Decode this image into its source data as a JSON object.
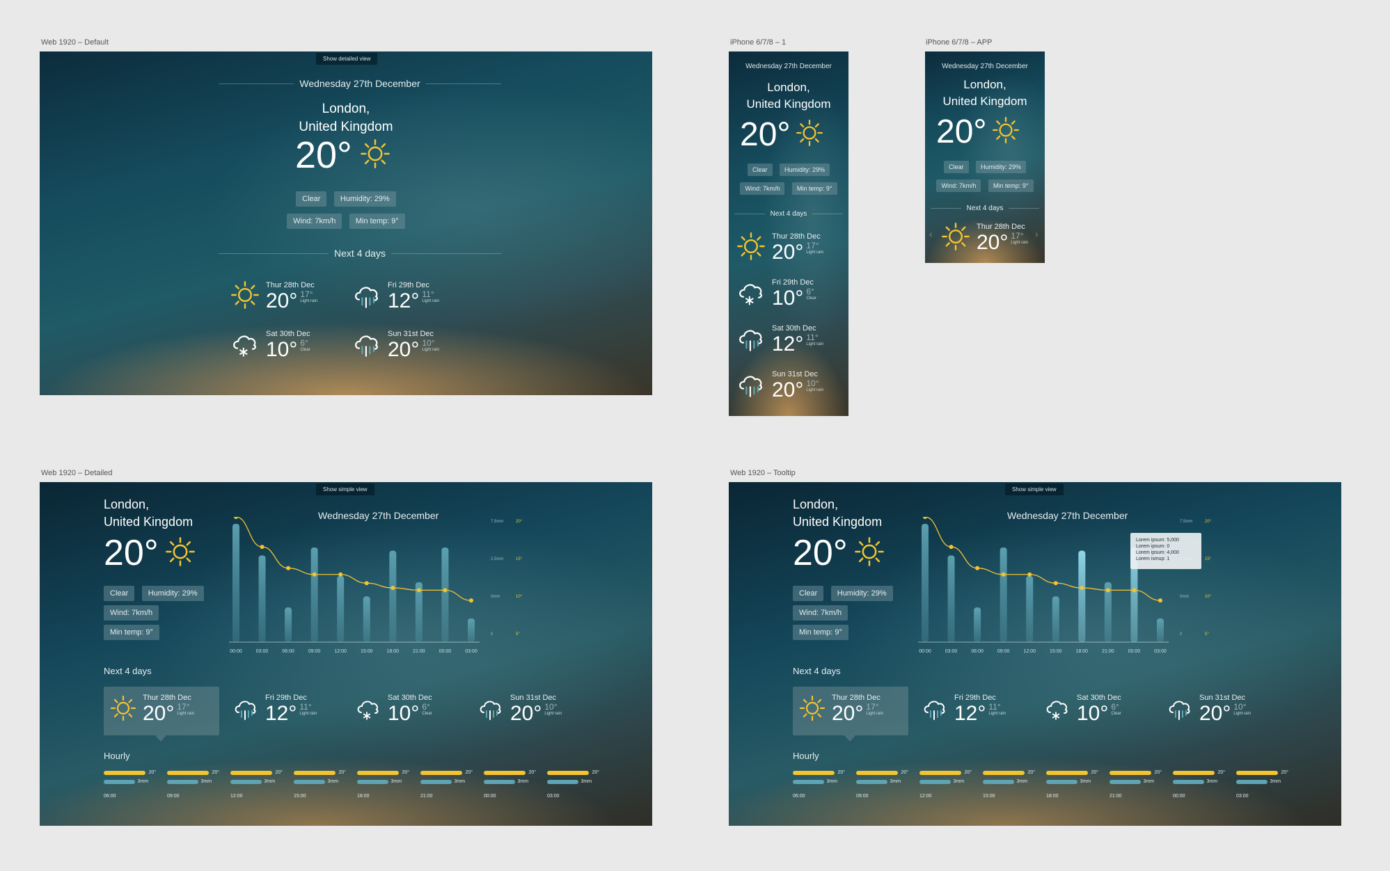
{
  "artboards": {
    "default": "Web 1920 – Default",
    "iphone1": "iPhone 6/7/8 – 1",
    "iphone_app": "iPhone 6/7/8 – APP",
    "detailed": "Web 1920 – Detailed",
    "tooltip": "Web 1920 – Tooltip"
  },
  "toggles": {
    "detailed": "Show detailed view",
    "simple": "Show simple view"
  },
  "current": {
    "date": "Wednesday 27th December",
    "city_line1": "London,",
    "city_line2": "United Kingdom",
    "temp": "20°",
    "condition": "Clear",
    "humidity": "Humidity: 29%",
    "wind": "Wind: 7km/h",
    "min_temp": "Min temp: 9°",
    "icon": "sun-icon"
  },
  "next_title": "Next 4 days",
  "days": [
    {
      "name": "Thur 28th Dec",
      "temp": "20°",
      "min": "17°",
      "cond": "Light rain",
      "icon": "sun-icon"
    },
    {
      "name": "Fri 29th Dec",
      "temp": "12°",
      "min": "11°",
      "cond": "Light rain",
      "icon": "rain-cloud-icon"
    },
    {
      "name": "Sat 30th Dec",
      "temp": "10°",
      "min": "6°",
      "cond": "Clear",
      "icon": "snow-cloud-icon"
    },
    {
      "name": "Sun 31st Dec",
      "temp": "20°",
      "min": "10°",
      "cond": "Light rain",
      "icon": "rain-cloud-icon"
    }
  ],
  "mobile_days": [
    {
      "name": "Thur 28th Dec",
      "temp": "20°",
      "min": "17°",
      "cond": "Light rain",
      "icon": "sun-icon"
    },
    {
      "name": "Fri 29th Dec",
      "temp": "10°",
      "min": "6°",
      "cond": "Clear",
      "icon": "snow-cloud-icon"
    },
    {
      "name": "Sat 30th Dec",
      "temp": "12°",
      "min": "11°",
      "cond": "Light rain",
      "icon": "rain-cloud-icon"
    },
    {
      "name": "Sun 31st Dec",
      "temp": "20°",
      "min": "10°",
      "cond": "Light rain",
      "icon": "rain-cloud-icon"
    }
  ],
  "hourly_title": "Hourly",
  "hourly": [
    {
      "time": "06:00",
      "temp": "20°",
      "rain": "3mm",
      "temp_frac": 0.9,
      "rain_frac": 0.75
    },
    {
      "time": "09:00",
      "temp": "20°",
      "rain": "3mm",
      "temp_frac": 0.9,
      "rain_frac": 0.75
    },
    {
      "time": "12:00",
      "temp": "20°",
      "rain": "3mm",
      "temp_frac": 0.9,
      "rain_frac": 0.75
    },
    {
      "time": "15:00",
      "temp": "20°",
      "rain": "3mm",
      "temp_frac": 0.9,
      "rain_frac": 0.75
    },
    {
      "time": "18:00",
      "temp": "20°",
      "rain": "3mm",
      "temp_frac": 0.9,
      "rain_frac": 0.75
    },
    {
      "time": "21:00",
      "temp": "20°",
      "rain": "3mm",
      "temp_frac": 0.9,
      "rain_frac": 0.75
    },
    {
      "time": "00:00",
      "temp": "20°",
      "rain": "3mm",
      "temp_frac": 0.9,
      "rain_frac": 0.75
    },
    {
      "time": "03:00",
      "temp": "20°",
      "rain": "3mm",
      "temp_frac": 0.9,
      "rain_frac": 0.75
    }
  ],
  "tooltip": [
    "Lorem ipsum: 5,000",
    "Lorem ipsum: 0",
    "Lorem ipsum: 4,000",
    "Lorem ismup: 1"
  ],
  "colors": {
    "accent": "#f4c430",
    "bar": "#5fa4b4",
    "bar_highlight": "#7cc4d4"
  },
  "chart_data": {
    "type": "bar",
    "categories": [
      "00:00",
      "03:00",
      "06:00",
      "09:00",
      "12:00",
      "15:00",
      "18:00",
      "21:00",
      "00:00",
      "03:00"
    ],
    "series": [
      {
        "values": [
          7.5,
          5.5,
          2.2,
          6.0,
          4.2,
          2.9,
          5.8,
          3.8,
          6.0,
          1.5
        ]
      },
      {
        "values": [
          20,
          16.2,
          13.5,
          12.7,
          12.7,
          11.6,
          11.0,
          10.7,
          10.7,
          9.4
        ]
      }
    ],
    "right_axis_rain": {
      "ticks": [
        "7.5mm",
        "2.5mm",
        "0mm",
        "0"
      ],
      "range": [
        0,
        7.5
      ]
    },
    "right_axis_temp": {
      "ticks": [
        "20°",
        "15°",
        "10°",
        "5°"
      ],
      "range": [
        5,
        20
      ]
    },
    "grid": false
  }
}
